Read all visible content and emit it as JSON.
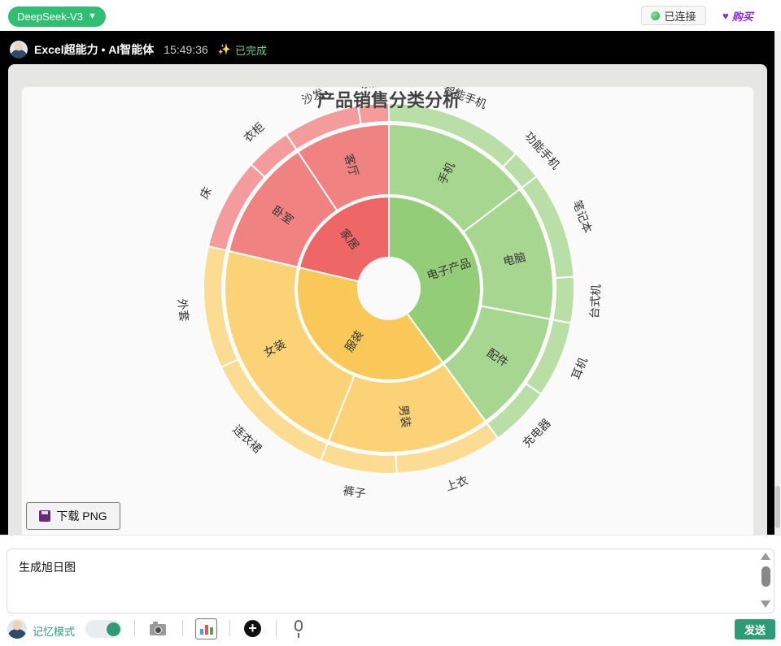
{
  "topbar": {
    "model_label": "DeepSeek-V3",
    "connection_label": "已连接",
    "buy_label": "购买"
  },
  "message": {
    "agent_name": "Excel超能力 • AI智能体",
    "time": "15:49:36",
    "status": "已完成"
  },
  "chart_data": {
    "type": "sunburst",
    "title": "产品销售分类分析",
    "colors": {
      "electronics": "#93cd77",
      "clothing": "#fac858",
      "home": "#ee6666"
    },
    "tree": [
      {
        "name": "电子产品",
        "value": 150,
        "children": [
          {
            "name": "手机",
            "value": 55,
            "children": [
              {
                "name": "智能手机",
                "value": 45
              },
              {
                "name": "功能手机",
                "value": 10
              }
            ]
          },
          {
            "name": "电脑",
            "value": 50,
            "children": [
              {
                "name": "笔记本",
                "value": 35
              },
              {
                "name": "台式机",
                "value": 15
              }
            ]
          },
          {
            "name": "配件",
            "value": 45,
            "children": [
              {
                "name": "耳机",
                "value": 25
              },
              {
                "name": "充电器",
                "value": 20
              }
            ]
          }
        ]
      },
      {
        "name": "服装",
        "value": 145,
        "children": [
          {
            "name": "男装",
            "value": 60,
            "children": [
              {
                "name": "上衣",
                "value": 35
              },
              {
                "name": "裤子",
                "value": 25
              }
            ]
          },
          {
            "name": "女装",
            "value": 85,
            "children": [
              {
                "name": "连衣裙",
                "value": 45
              },
              {
                "name": "外套",
                "value": 40
              }
            ]
          }
        ]
      },
      {
        "name": "家居",
        "value": 80,
        "children": [
          {
            "name": "卧室",
            "value": 45,
            "children": [
              {
                "name": "床",
                "value": 30
              },
              {
                "name": "衣柜",
                "value": 15
              }
            ]
          },
          {
            "name": "客厅",
            "value": 35,
            "children": [
              {
                "name": "沙发",
                "value": 25
              },
              {
                "name": "茶几",
                "value": 10
              }
            ]
          }
        ]
      }
    ]
  },
  "download_label": "下载 PNG",
  "input": {
    "value": "生成旭日图"
  },
  "bottom": {
    "memory_label": "记忆模式",
    "send_label": "发送"
  }
}
